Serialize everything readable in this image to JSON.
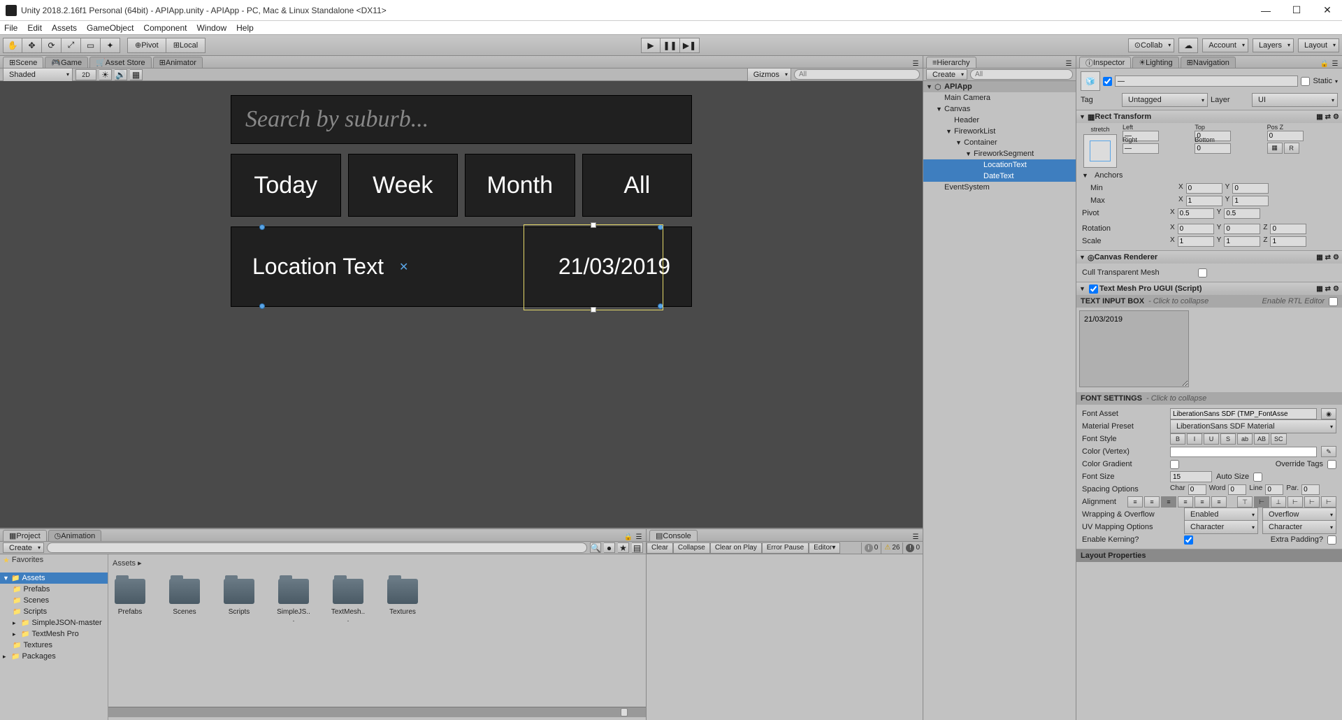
{
  "window": {
    "title": "Unity 2018.2.16f1 Personal (64bit) - APIApp.unity - APIApp - PC, Mac & Linux Standalone <DX11>"
  },
  "menu": [
    "File",
    "Edit",
    "Assets",
    "GameObject",
    "Component",
    "Window",
    "Help"
  ],
  "toolbar": {
    "pivot": "Pivot",
    "local": "Local",
    "collab": "Collab",
    "account": "Account",
    "layers": "Layers",
    "layout": "Layout"
  },
  "tabs": {
    "scene": "Scene",
    "game": "Game",
    "assetstore": "Asset Store",
    "animator": "Animator",
    "hierarchy": "Hierarchy",
    "project": "Project",
    "animation": "Animation",
    "console": "Console",
    "inspector": "Inspector",
    "lighting": "Lighting",
    "navigation": "Navigation"
  },
  "scene_toolbar": {
    "shaded": "Shaded",
    "mode2d": "2D",
    "gizmos": "Gizmos",
    "search_placeholder": "All"
  },
  "canvas": {
    "search_placeholder": "Search by suburb...",
    "filters": [
      "Today",
      "Week",
      "Month",
      "All"
    ],
    "location_text": "Location Text",
    "date_text": "21/03/2019"
  },
  "hierarchy": {
    "create": "Create",
    "search_placeholder": "All",
    "scene": "APIApp",
    "items": [
      {
        "name": "Main Camera",
        "indent": 1
      },
      {
        "name": "Canvas",
        "indent": 1,
        "expanded": true
      },
      {
        "name": "Header",
        "indent": 2
      },
      {
        "name": "FireworkList",
        "indent": 2,
        "expanded": true
      },
      {
        "name": "Container",
        "indent": 3,
        "expanded": true
      },
      {
        "name": "FireworkSegment",
        "indent": 4,
        "expanded": true
      },
      {
        "name": "LocationText",
        "indent": 5,
        "selected": true
      },
      {
        "name": "DateText",
        "indent": 5,
        "selected": true
      },
      {
        "name": "EventSystem",
        "indent": 1
      }
    ]
  },
  "project": {
    "create": "Create",
    "favorites": "Favorites",
    "assets": "Assets",
    "tree": [
      "Prefabs",
      "Scenes",
      "Scripts",
      "SimpleJSON-master",
      "TextMesh Pro",
      "Textures"
    ],
    "packages": "Packages",
    "breadcrumb": "Assets",
    "folders": [
      "Prefabs",
      "Scenes",
      "Scripts",
      "SimpleJS...",
      "TextMesh...",
      "Textures"
    ]
  },
  "console": {
    "clear": "Clear",
    "collapse": "Collapse",
    "clear_on_play": "Clear on Play",
    "error_pause": "Error Pause",
    "editor": "Editor",
    "info_count": "0",
    "warn_count": "26",
    "error_count": "0"
  },
  "inspector": {
    "name_dash": "—",
    "static": "Static",
    "tag_label": "Tag",
    "tag_value": "Untagged",
    "layer_label": "Layer",
    "layer_value": "UI",
    "rect_transform": {
      "title": "Rect Transform",
      "stretch": "stretch",
      "left": "Left",
      "left_v": "—",
      "top": "Top",
      "top_v": "0",
      "posz": "Pos Z",
      "posz_v": "0",
      "right": "Right",
      "right_v": "—",
      "bottom": "Bottom",
      "bottom_v": "0",
      "anchors": "Anchors",
      "min": "Min",
      "min_x": "0",
      "min_y": "0",
      "max": "Max",
      "max_x": "1",
      "max_y": "1",
      "pivot": "Pivot",
      "pivot_x": "0.5",
      "pivot_y": "0.5",
      "rotation": "Rotation",
      "rot_x": "0",
      "rot_y": "0",
      "rot_z": "0",
      "scale": "Scale",
      "scale_x": "1",
      "scale_y": "1",
      "scale_z": "1",
      "r_btn": "R"
    },
    "canvas_renderer": {
      "title": "Canvas Renderer",
      "cull": "Cull Transparent Mesh"
    },
    "tmp": {
      "title": "Text Mesh Pro UGUI (Script)",
      "text_input_box": "TEXT INPUT BOX",
      "click_collapse": "- Click to collapse",
      "enable_rtl": "Enable RTL Editor",
      "text_value": "21/03/2019",
      "font_settings": "FONT SETTINGS",
      "font_asset": "Font Asset",
      "font_asset_v": "LiberationSans SDF (TMP_FontAsse",
      "material_preset": "Material Preset",
      "material_preset_v": "LiberationSans SDF Material",
      "font_style": "Font Style",
      "style_btns": [
        "B",
        "I",
        "U",
        "S",
        "ab",
        "AB",
        "SC"
      ],
      "color_vertex": "Color (Vertex)",
      "color_gradient": "Color Gradient",
      "override_tags": "Override Tags",
      "font_size": "Font Size",
      "font_size_v": "15",
      "auto_size": "Auto Size",
      "spacing": "Spacing Options",
      "char": "Char",
      "char_v": "0",
      "word": "Word",
      "word_v": "0",
      "line": "Line",
      "line_v": "0",
      "par": "Par.",
      "par_v": "0",
      "alignment": "Alignment",
      "wrapping": "Wrapping & Overflow",
      "wrap_v": "Enabled",
      "overflow_v": "Overflow",
      "uv_mapping": "UV Mapping Options",
      "uv1": "Character",
      "uv2": "Character",
      "kerning": "Enable Kerning?",
      "extra_padding": "Extra Padding?"
    },
    "layout_props": "Layout Properties"
  }
}
